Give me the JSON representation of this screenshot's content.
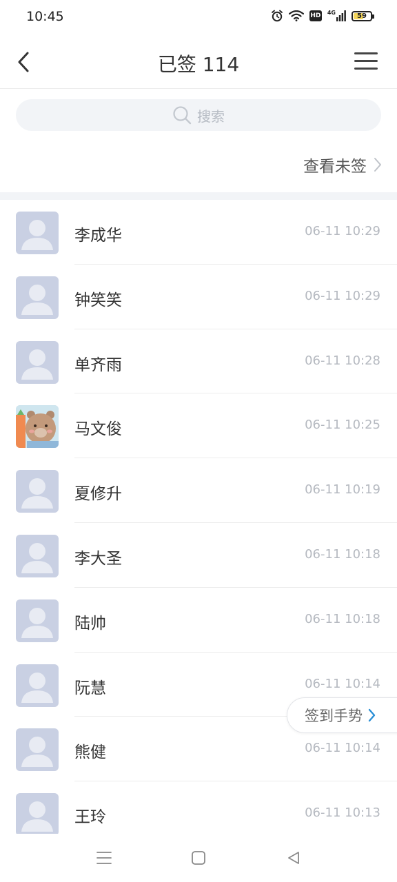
{
  "status_bar": {
    "time": "10:45",
    "hd": "HD",
    "network": "4G",
    "battery": "59",
    "battery_level": 0.59,
    "icons": [
      "alarm-icon",
      "wifi-icon",
      "hd-icon",
      "signal-icon",
      "battery-icon"
    ]
  },
  "header": {
    "title": "已签 114",
    "back_icon": "chevron-left-icon",
    "menu_icon": "hamburger-menu-icon"
  },
  "search": {
    "placeholder": "搜索",
    "icon": "search-icon"
  },
  "unsigned_link": {
    "label": "查看未签",
    "icon": "chevron-right-icon"
  },
  "list": [
    {
      "name": "李成华",
      "time": "06-11 10:29",
      "avatar": "default-avatar"
    },
    {
      "name": "钟笑笑",
      "time": "06-11 10:29",
      "avatar": "default-avatar"
    },
    {
      "name": "单齐雨",
      "time": "06-11 10:28",
      "avatar": "default-avatar"
    },
    {
      "name": "马文俊",
      "time": "06-11 10:25",
      "avatar": "bear-photo-avatar"
    },
    {
      "name": "夏修升",
      "time": "06-11 10:19",
      "avatar": "default-avatar"
    },
    {
      "name": "李大圣",
      "time": "06-11 10:18",
      "avatar": "default-avatar"
    },
    {
      "name": "陆帅",
      "time": "06-11 10:18",
      "avatar": "default-avatar"
    },
    {
      "name": "阮慧",
      "time": "06-11 10:14",
      "avatar": "default-avatar"
    },
    {
      "name": "熊健",
      "time": "06-11 10:14",
      "avatar": "default-avatar"
    },
    {
      "name": "王玲",
      "time": "06-11 10:13",
      "avatar": "default-avatar"
    }
  ],
  "gesture_button": {
    "label": "签到手势",
    "icon": "chevron-right-icon",
    "accent": "#2a8fd6"
  },
  "system_nav": {
    "icons": [
      "menu-lines-icon",
      "home-square-icon",
      "back-triangle-icon"
    ]
  },
  "colors": {
    "avatar_bg": "#c9d0e3",
    "divider_band": "#f2f4f7",
    "time_text": "#b5b9c0"
  }
}
